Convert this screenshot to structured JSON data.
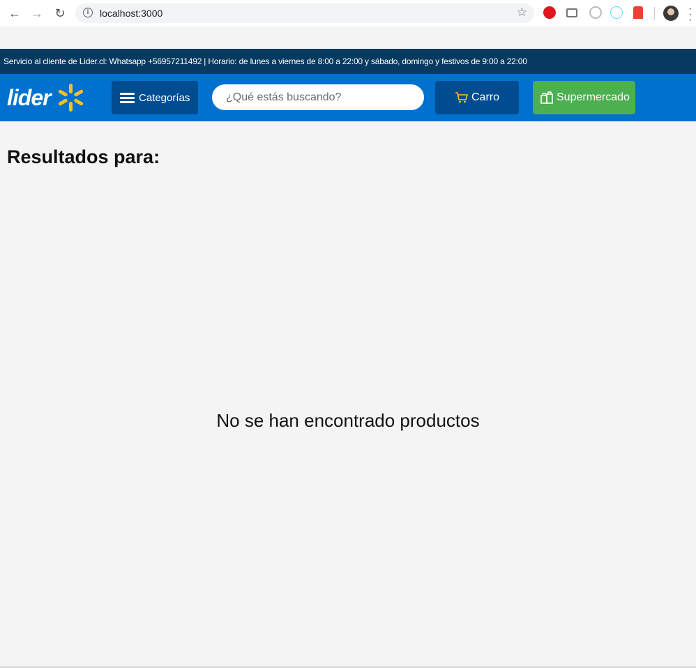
{
  "browser": {
    "url": "localhost:3000"
  },
  "announcement": {
    "text": "Servicio al cliente de Lider.cl: Whatsapp +56957211492 | Horario: de lunes a viernes de 8:00 a 22:00 y sábado, domingo y festivos de 9:00 a 22:00"
  },
  "header": {
    "logo_text": "lider",
    "categories_label": "Categorías",
    "search_placeholder": "¿Qué estás buscando?",
    "cart_label": "Carro",
    "supermarket_label": "Supermercado"
  },
  "main": {
    "results_title": "Resultados para:",
    "empty_message": "No se han encontrado productos"
  },
  "colors": {
    "announcement_bg": "#063a60",
    "header_bg": "#0071ce",
    "button_dark": "#004c91",
    "supermarket_green": "#4caf50",
    "spark_yellow": "#ffc220"
  },
  "icons": [
    "back-arrow-icon",
    "forward-arrow-icon",
    "reload-icon",
    "info-icon",
    "star-icon",
    "menu-icon",
    "cart-icon",
    "bag-icon",
    "spark-icon"
  ]
}
